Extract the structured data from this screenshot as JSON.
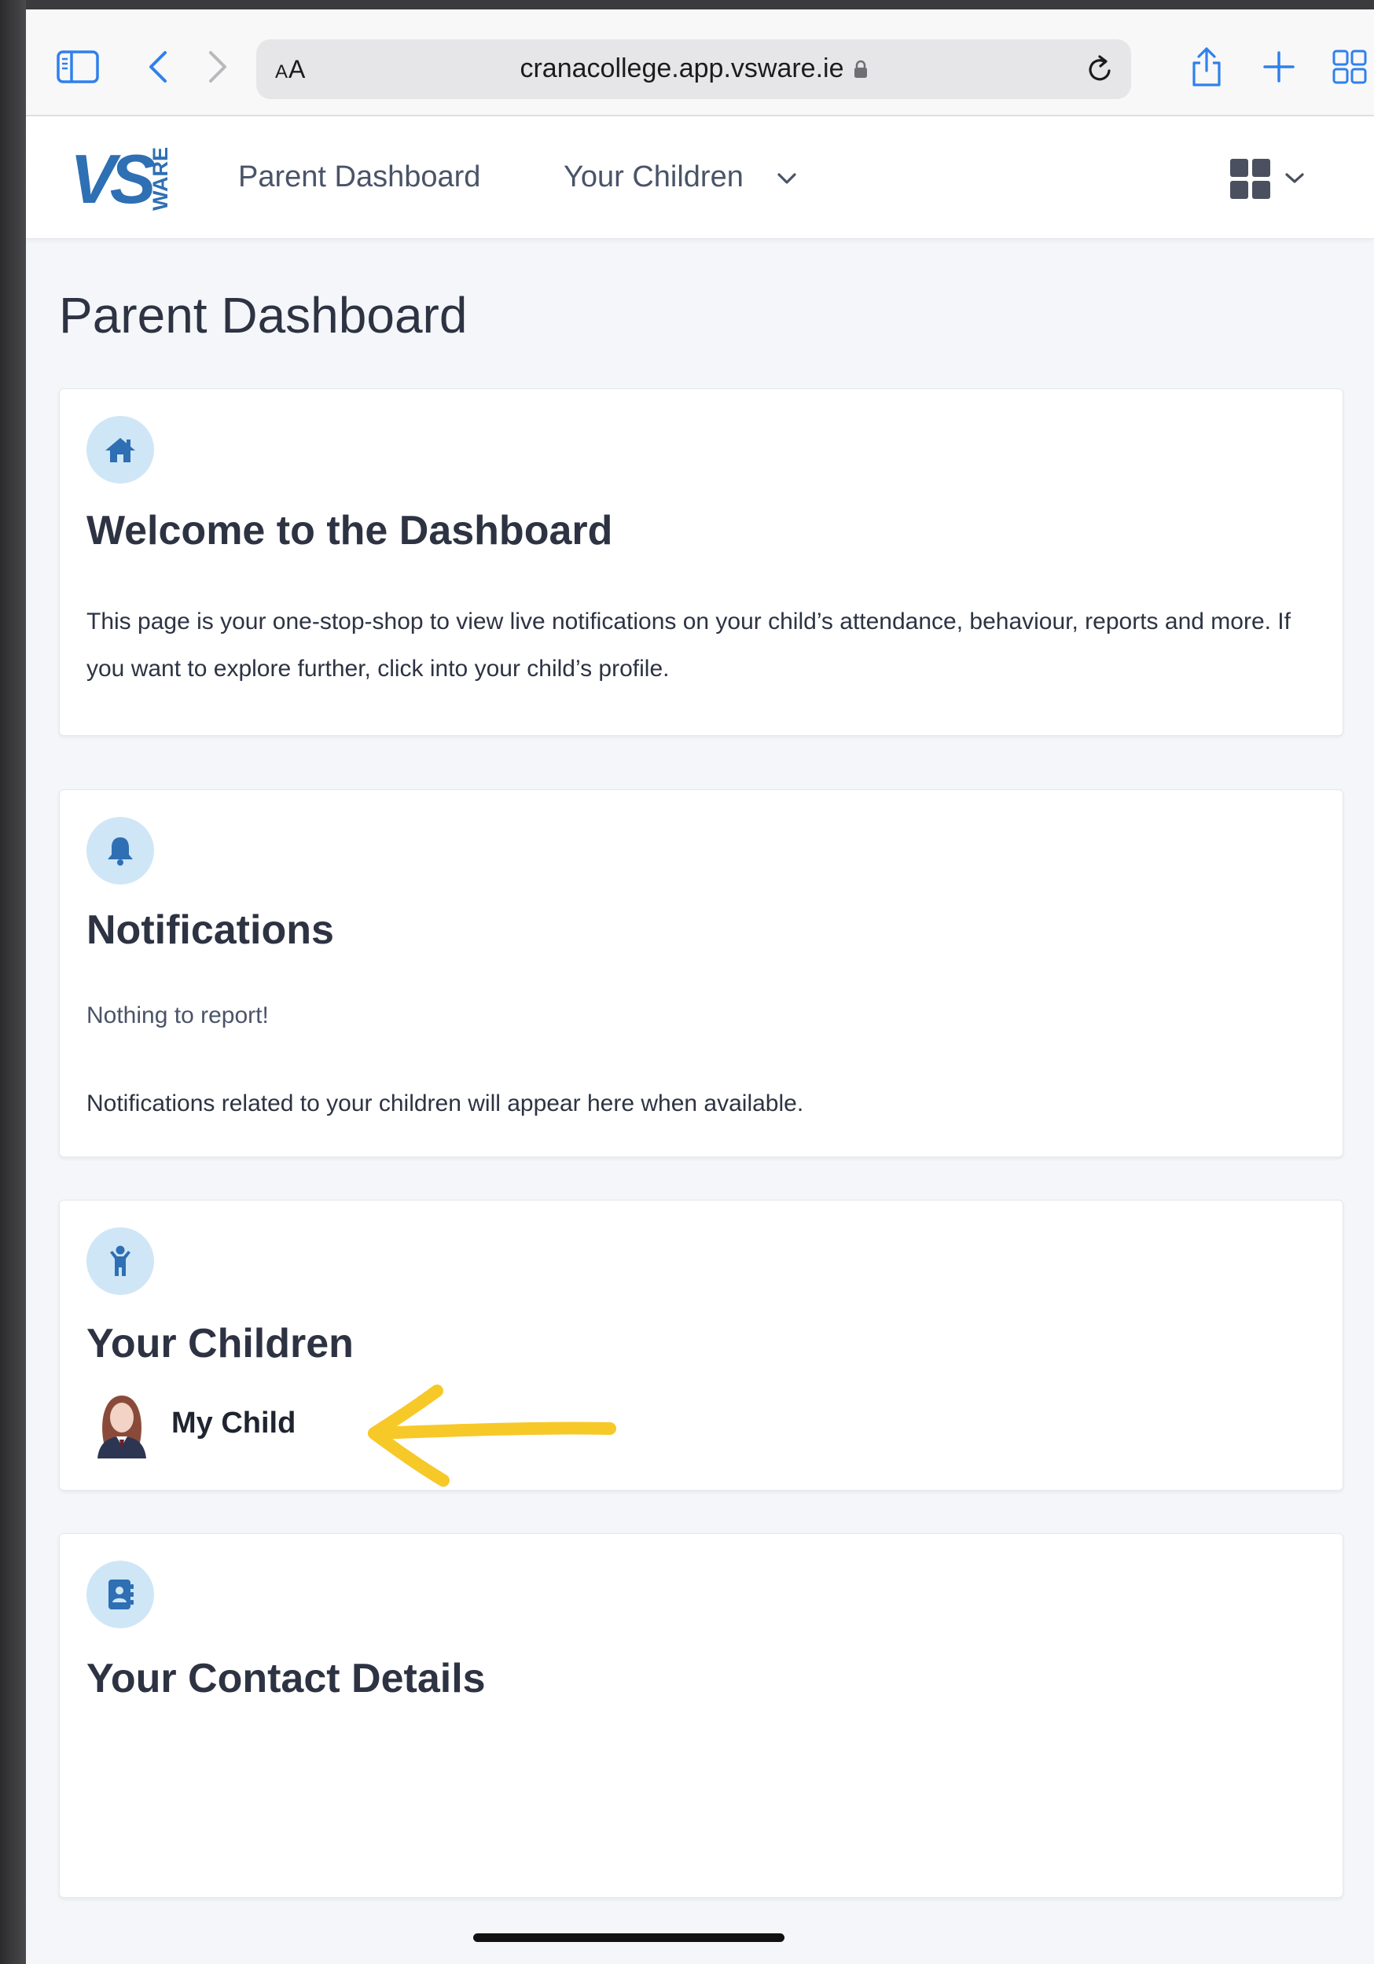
{
  "browser": {
    "text_size_label": "AA",
    "url": "cranacollege.app.vsware.ie"
  },
  "header": {
    "logo_text": "VS",
    "logo_subtext": "WARE",
    "nav": {
      "dashboard": "Parent Dashboard",
      "children": "Your Children"
    }
  },
  "page": {
    "title": "Parent Dashboard"
  },
  "cards": {
    "welcome": {
      "icon": "home-icon",
      "title": "Welcome to the Dashboard",
      "text": "This page is your one-stop-shop to view live notifications on your child’s attendance, behaviour, reports and more. If you want to explore further, click into your child’s profile."
    },
    "notifications": {
      "icon": "bell-icon",
      "title": "Notifications",
      "empty": "Nothing to report!",
      "info": "Notifications related to your children will appear here when available."
    },
    "children": {
      "icon": "child-icon",
      "title": "Your Children",
      "items": [
        {
          "name": "My Child"
        }
      ]
    },
    "contact": {
      "icon": "contact-book-icon",
      "title": "Your Contact Details"
    }
  },
  "colors": {
    "accent": "#2f6fb3",
    "icon_bg": "#cfe6f7",
    "page_bg": "#f4f6f9",
    "annotation_arrow": "#f7c928"
  }
}
